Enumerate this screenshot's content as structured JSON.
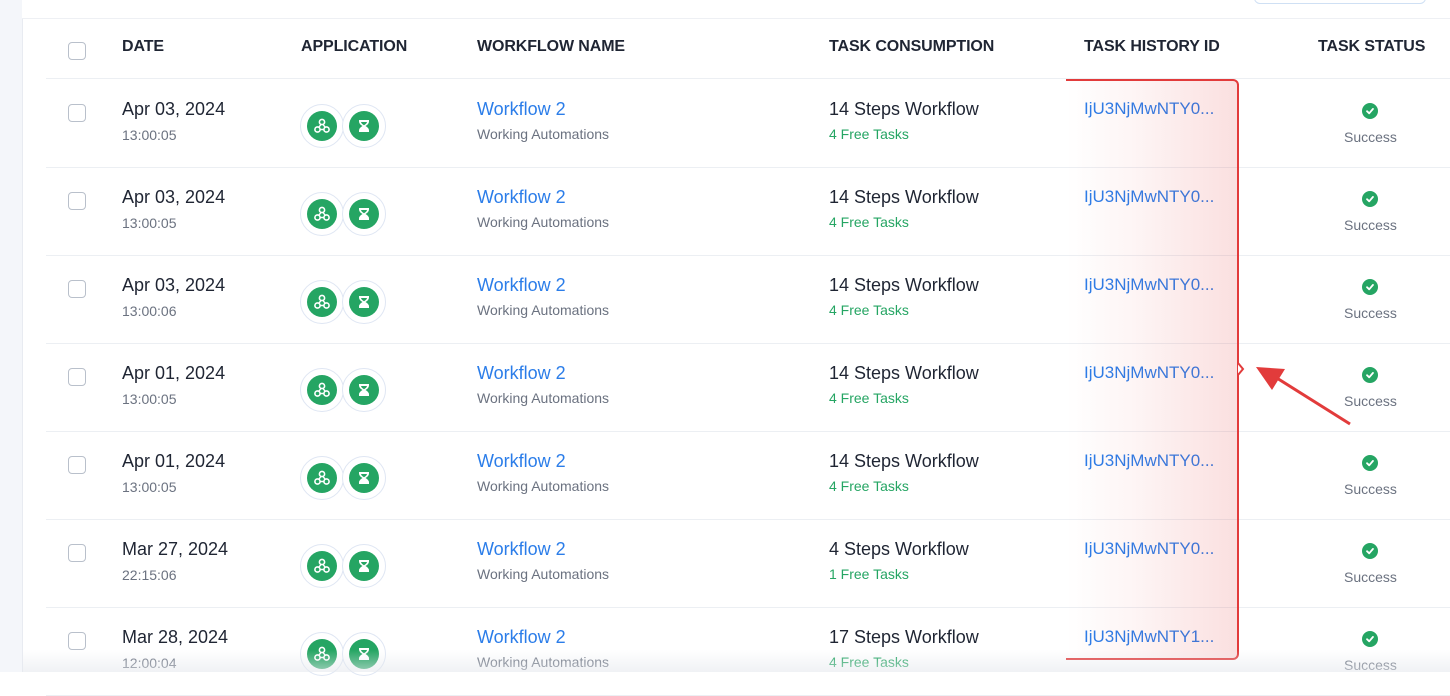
{
  "table": {
    "columns": {
      "date": "DATE",
      "application": "APPLICATION",
      "workflow_name": "WORKFLOW NAME",
      "task_consumption": "TASK CONSUMPTION",
      "task_history_id": "TASK HISTORY ID",
      "task_status": "TASK STATUS"
    },
    "app_icons": [
      "webhook-icon",
      "schedule-icon"
    ],
    "rows": [
      {
        "date": "Apr 03, 2024",
        "time": "13:00:05",
        "workflow": "Workflow 2",
        "folder": "Working Automations",
        "steps": "14 Steps Workflow",
        "tasks": "4 Free Tasks",
        "history_id": "IjU3NjMwNTY0...",
        "status": "Success"
      },
      {
        "date": "Apr 03, 2024",
        "time": "13:00:05",
        "workflow": "Workflow 2",
        "folder": "Working Automations",
        "steps": "14 Steps Workflow",
        "tasks": "4 Free Tasks",
        "history_id": "IjU3NjMwNTY0...",
        "status": "Success"
      },
      {
        "date": "Apr 03, 2024",
        "time": "13:00:06",
        "workflow": "Workflow 2",
        "folder": "Working Automations",
        "steps": "14 Steps Workflow",
        "tasks": "4 Free Tasks",
        "history_id": "IjU3NjMwNTY0...",
        "status": "Success"
      },
      {
        "date": "Apr 01, 2024",
        "time": "13:00:05",
        "workflow": "Workflow 2",
        "folder": "Working Automations",
        "steps": "14 Steps Workflow",
        "tasks": "4 Free Tasks",
        "history_id": "IjU3NjMwNTY0...",
        "status": "Success"
      },
      {
        "date": "Apr 01, 2024",
        "time": "13:00:05",
        "workflow": "Workflow 2",
        "folder": "Working Automations",
        "steps": "14 Steps Workflow",
        "tasks": "4 Free Tasks",
        "history_id": "IjU3NjMwNTY0...",
        "status": "Success"
      },
      {
        "date": "Mar 27, 2024",
        "time": "22:15:06",
        "workflow": "Workflow 2",
        "folder": "Working Automations",
        "steps": "4 Steps Workflow",
        "tasks": "1 Free Tasks",
        "history_id": "IjU3NjMwNTY0...",
        "status": "Success"
      },
      {
        "date": "Mar 28, 2024",
        "time": "12:00:04",
        "workflow": "Workflow 2",
        "folder": "Working Automations",
        "steps": "17 Steps Workflow",
        "tasks": "4 Free Tasks",
        "history_id": "IjU3NjMwNTY1...",
        "status": "Success"
      }
    ]
  },
  "colors": {
    "link": "#2b7de9",
    "success": "#25a563",
    "annotation": "#e23b3b"
  }
}
